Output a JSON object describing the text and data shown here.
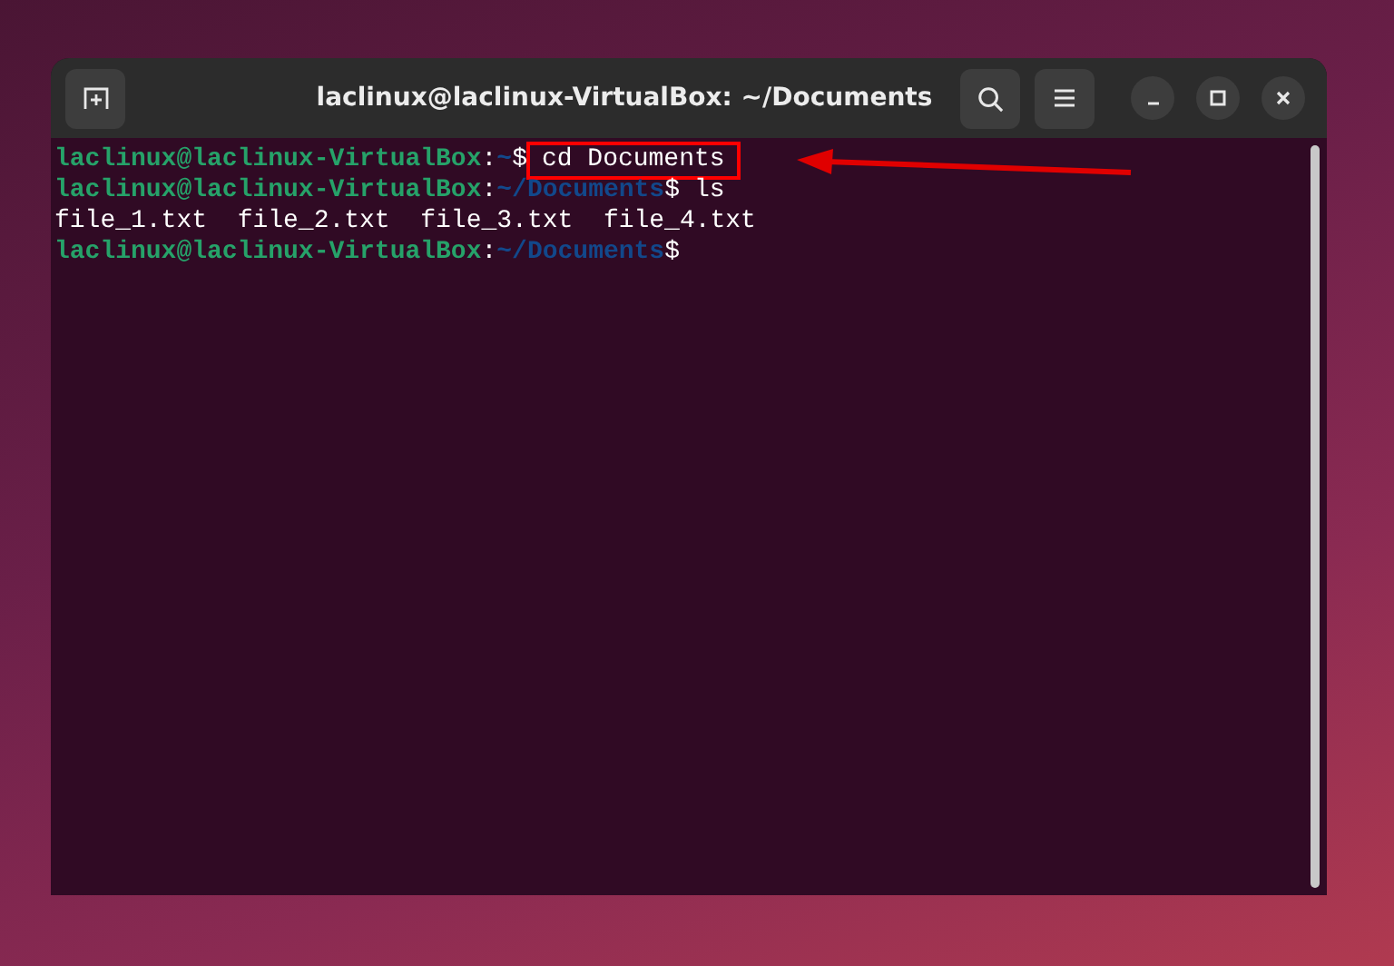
{
  "window": {
    "title": "laclinux@laclinux-VirtualBox: ~/Documents"
  },
  "terminal": {
    "lines": [
      {
        "kind": "prompt",
        "user": "laclinux@laclinux-VirtualBox",
        "separator": ":",
        "path": "~",
        "symbol": "$",
        "command": "cd Documents",
        "highlighted": true
      },
      {
        "kind": "prompt",
        "user": "laclinux@laclinux-VirtualBox",
        "separator": ":",
        "path": "~/Documents",
        "symbol": "$",
        "command": "ls",
        "highlighted": false
      },
      {
        "kind": "output",
        "text": "file_1.txt  file_2.txt  file_3.txt  file_4.txt"
      },
      {
        "kind": "prompt",
        "user": "laclinux@laclinux-VirtualBox",
        "separator": ":",
        "path": "~/Documents",
        "symbol": "$"
      }
    ]
  }
}
